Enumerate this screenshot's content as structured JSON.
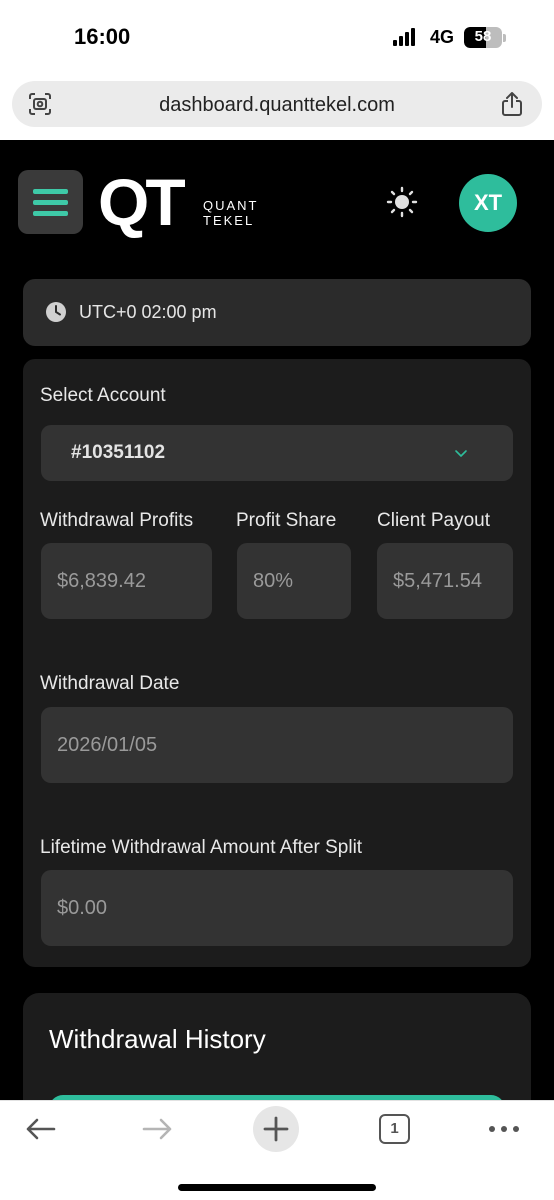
{
  "status_bar": {
    "time": "16:00",
    "network": "4G",
    "battery": "58",
    "battery_level": 0.58
  },
  "browser": {
    "url": "dashboard.quanttekel.com",
    "tab_count": "1"
  },
  "header": {
    "logo_mark": "QT",
    "logo_line1": "QUANT",
    "logo_line2": "TEKEL",
    "avatar_initials": "XT"
  },
  "time_card": {
    "text": "UTC+0 02:00 pm"
  },
  "form": {
    "select_account_label": "Select Account",
    "account_value": "#10351102",
    "withdrawal_profits_label": "Withdrawal Profits",
    "withdrawal_profits_value": "$6,839.42",
    "profit_share_label": "Profit Share",
    "profit_share_value": "80%",
    "client_payout_label": "Client Payout",
    "client_payout_value": "$5,471.54",
    "withdrawal_date_label": "Withdrawal Date",
    "withdrawal_date_value": "2026/01/05",
    "lifetime_label": "Lifetime Withdrawal Amount After Split",
    "lifetime_value": "$0.00"
  },
  "history": {
    "title": "Withdrawal History"
  },
  "colors": {
    "accent": "#2ebd9c",
    "background": "#000000",
    "card": "#1c1c1c",
    "field": "#333333"
  },
  "icons": [
    "scan-icon",
    "share-icon",
    "menu-icon",
    "sun-icon",
    "clock-icon",
    "chevron-down-icon",
    "back-arrow-icon",
    "forward-arrow-icon",
    "plus-icon",
    "tabs-icon",
    "more-icon"
  ]
}
